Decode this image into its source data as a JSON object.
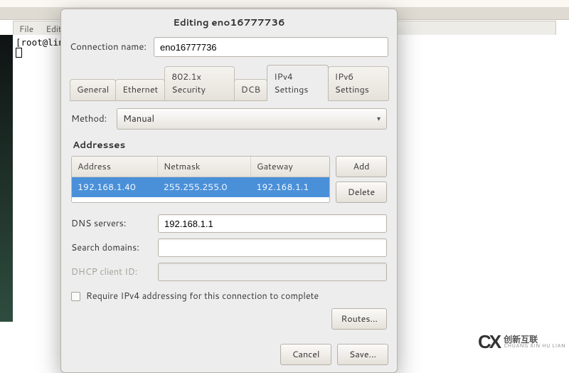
{
  "background": {
    "menu_file": "File",
    "menu_edit": "Edit",
    "terminal": "[root@lin"
  },
  "dialog": {
    "title": "Editing eno16777736",
    "conn_name_label": "Connection name:",
    "conn_name_value": "eno16777736",
    "tabs": {
      "general": "General",
      "ethernet": "Ethernet",
      "sec8021x": "802.1x Security",
      "dcb": "DCB",
      "ipv4": "IPv4 Settings",
      "ipv6": "IPv6 Settings"
    },
    "ipv4": {
      "method_label": "Method:",
      "method_value": "Manual",
      "addresses_header": "Addresses",
      "cols": {
        "address": "Address",
        "netmask": "Netmask",
        "gateway": "Gateway"
      },
      "rows": [
        {
          "address": "192.168.1.40",
          "netmask": "255.255.255.0",
          "gateway": "192.168.1.1"
        }
      ],
      "add_btn": "Add",
      "delete_btn": "Delete",
      "dns_label": "DNS servers:",
      "dns_value": "192.168.1.1",
      "search_label": "Search domains:",
      "search_value": "",
      "dhcp_label": "DHCP client ID:",
      "dhcp_value": "",
      "require_label": "Require IPv4 addressing for this connection to complete",
      "routes_btn": "Routes…"
    },
    "cancel": "Cancel",
    "save": "Save…"
  },
  "watermark": {
    "cn": "创新互联",
    "py": "CHUANG XIN HU LIAN"
  }
}
